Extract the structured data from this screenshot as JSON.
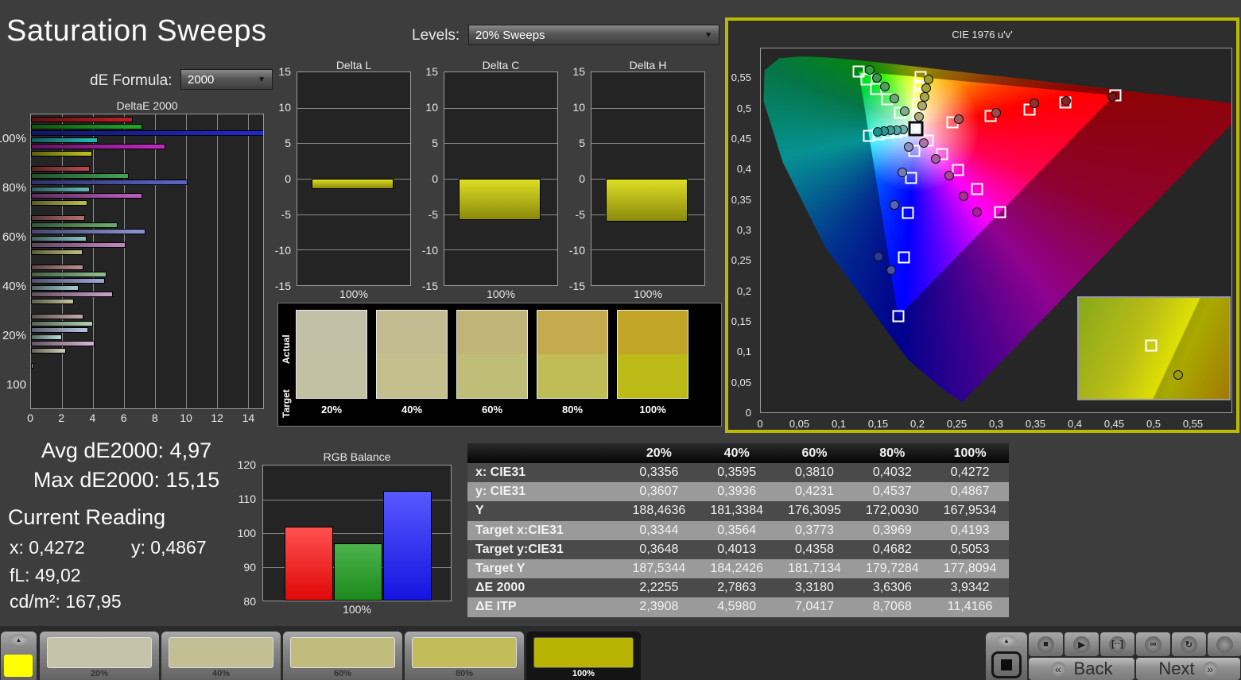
{
  "app": {
    "title": "Saturation Sweeps"
  },
  "icons": {
    "chevron_down": "▼",
    "chevron_up": "▲",
    "back_chevrons": "«",
    "next_chevrons": "»"
  },
  "controls": {
    "de_formula": {
      "label": "dE Formula:",
      "value": "2000"
    },
    "levels": {
      "label": "Levels:",
      "value": "20% Sweeps"
    }
  },
  "summary": {
    "avg_label": "Avg dE2000:",
    "avg_value": "4,97",
    "max_label": "Max dE2000:",
    "max_value": "15,15"
  },
  "current_reading": {
    "title": "Current Reading",
    "x_label": "x:",
    "x_value": "0,4272",
    "y_label": "y:",
    "y_value": "0,4867",
    "fl_label": "fL:",
    "fl_value": "49,02",
    "cd_label": "cd/m²:",
    "cd_value": "167,95"
  },
  "chart_data": [
    {
      "id": "deltae2000",
      "type": "bar",
      "orientation": "horizontal",
      "title": "DeltaE 2000",
      "xlim": [
        0,
        15
      ],
      "xticks": [
        0,
        2,
        4,
        6,
        8,
        10,
        12,
        14
      ],
      "groups": [
        {
          "label": "100%",
          "values": [
            6.6,
            7.2,
            15.15,
            4.3,
            8.7,
            3.93
          ],
          "colors": [
            "#b52025",
            "#21a228",
            "#2028c8",
            "#27b4b4",
            "#bb28bb",
            "#bcbc22"
          ]
        },
        {
          "label": "80%",
          "values": [
            3.8,
            6.3,
            10.1,
            3.8,
            7.2,
            3.63
          ],
          "colors": [
            "#b04a4a",
            "#3f9f4f",
            "#5a62c4",
            "#62b2b2",
            "#b75ab7",
            "#b5b54a"
          ]
        },
        {
          "label": "60%",
          "values": [
            3.5,
            5.6,
            7.4,
            3.6,
            6.1,
            3.32
          ],
          "colors": [
            "#b06a6a",
            "#6aa86a",
            "#8890cc",
            "#84bcbc",
            "#bd84bd",
            "#b7b77a"
          ]
        },
        {
          "label": "40%",
          "values": [
            3.4,
            4.9,
            4.8,
            3.1,
            5.3,
            2.79
          ],
          "colors": [
            "#b88888",
            "#8cba8c",
            "#9aa2d6",
            "#9cc6c6",
            "#c49cc4",
            "#bcbc96"
          ]
        },
        {
          "label": "20%",
          "values": [
            3.4,
            4.0,
            3.7,
            2.0,
            4.1,
            2.24
          ],
          "colors": [
            "#c0a4a4",
            "#aacaaa",
            "#b4bce0",
            "#b0d4d4",
            "#ccb0cc",
            "#c6c6b0"
          ]
        },
        {
          "label": "100",
          "values": [
            0.15
          ],
          "colors": [
            "#e8e8e8"
          ]
        }
      ],
      "series_names": [
        "Red",
        "Green",
        "Blue",
        "Cyan",
        "Magenta",
        "Yellow"
      ]
    },
    {
      "id": "delta-l",
      "type": "bar",
      "title": "Delta L",
      "xlabel": "100%",
      "categories": [
        "100%"
      ],
      "values": [
        -1.5
      ],
      "ylim": [
        -15,
        15
      ],
      "yticks": [
        15,
        10,
        5,
        0,
        -5,
        -10,
        -15
      ]
    },
    {
      "id": "delta-c",
      "type": "bar",
      "title": "Delta C",
      "xlabel": "100%",
      "categories": [
        "100%"
      ],
      "values": [
        -5.8
      ],
      "ylim": [
        -15,
        15
      ],
      "yticks": [
        15,
        10,
        5,
        0,
        -5,
        -10,
        -15
      ]
    },
    {
      "id": "delta-h",
      "type": "bar",
      "title": "Delta H",
      "xlabel": "100%",
      "categories": [
        "100%"
      ],
      "values": [
        -6.0
      ],
      "ylim": [
        -15,
        15
      ],
      "yticks": [
        15,
        10,
        5,
        0,
        -5,
        -10,
        -15
      ]
    },
    {
      "id": "rgb-balance",
      "type": "bar",
      "title": "RGB Balance",
      "xlabel": "100%",
      "categories": [
        "100%"
      ],
      "ylim": [
        80,
        120
      ],
      "yticks": [
        120,
        110,
        100,
        90,
        80
      ],
      "series": [
        {
          "name": "Red",
          "value": 102,
          "color_top": "#ff5050",
          "color_bottom": "#e00808"
        },
        {
          "name": "Green",
          "value": 97,
          "color_top": "#4db34d",
          "color_bottom": "#1b8a1b"
        },
        {
          "name": "Blue",
          "value": 112.5,
          "color_top": "#5858ff",
          "color_bottom": "#1414e0"
        }
      ]
    },
    {
      "id": "cie",
      "type": "scatter",
      "title": "CIE 1976 u'v'",
      "xlim": [
        0,
        0.6
      ],
      "ylim": [
        0,
        0.6
      ],
      "tick_values": [
        0,
        0.05,
        0.1,
        0.15,
        0.2,
        0.25,
        0.3,
        0.35,
        0.4,
        0.45,
        0.5,
        0.55
      ],
      "tick_labels": [
        "0",
        "0,05",
        "0,1",
        "0,15",
        "0,2",
        "0,25",
        "0,3",
        "0,35",
        "0,4",
        "0,45",
        "0,5",
        "0,55"
      ],
      "white_point": {
        "u": 0.1978,
        "v": 0.4683
      },
      "targets": [
        {
          "u": 0.2442,
          "v": 0.4783
        },
        {
          "u": 0.2926,
          "v": 0.4888
        },
        {
          "u": 0.343,
          "v": 0.4996
        },
        {
          "u": 0.388,
          "v": 0.511
        },
        {
          "u": 0.4516,
          "v": 0.5229
        },
        {
          "u": 0.1778,
          "v": 0.4942
        },
        {
          "u": 0.1612,
          "v": 0.5157
        },
        {
          "u": 0.1472,
          "v": 0.5338
        },
        {
          "u": 0.1353,
          "v": 0.5492
        },
        {
          "u": 0.125,
          "v": 0.5625
        },
        {
          "u": 0.1952,
          "v": 0.4314
        },
        {
          "u": 0.1919,
          "v": 0.386
        },
        {
          "u": 0.1878,
          "v": 0.3293
        },
        {
          "u": 0.1825,
          "v": 0.256
        },
        {
          "u": 0.1754,
          "v": 0.1579
        },
        {
          "u": 0.1857,
          "v": 0.4657
        },
        {
          "u": 0.1737,
          "v": 0.4631
        },
        {
          "u": 0.1617,
          "v": 0.4605
        },
        {
          "u": 0.15,
          "v": 0.458
        },
        {
          "u": 0.1383,
          "v": 0.4555
        },
        {
          "u": 0.2131,
          "v": 0.4485
        },
        {
          "u": 0.2308,
          "v": 0.4257
        },
        {
          "u": 0.2514,
          "v": 0.3991
        },
        {
          "u": 0.2758,
          "v": 0.3676
        },
        {
          "u": 0.305,
          "v": 0.3298
        },
        {
          "u": 0.1994,
          "v": 0.4894
        },
        {
          "u": 0.2007,
          "v": 0.5085
        },
        {
          "u": 0.2019,
          "v": 0.5247
        },
        {
          "u": 0.2029,
          "v": 0.5385
        },
        {
          "u": 0.2039,
          "v": 0.5529
        }
      ],
      "measurements": [
        {
          "u": 0.252,
          "v": 0.483,
          "color": "#a85858"
        },
        {
          "u": 0.3,
          "v": 0.494,
          "color": "#a34848"
        },
        {
          "u": 0.349,
          "v": 0.51,
          "color": "#992e2e"
        },
        {
          "u": 0.389,
          "v": 0.514,
          "color": "#8e2020"
        },
        {
          "u": 0.448,
          "v": 0.52,
          "color": "#7a1414"
        },
        {
          "u": 0.183,
          "v": 0.496,
          "color": "#7fae8b"
        },
        {
          "u": 0.17,
          "v": 0.518,
          "color": "#6aa878"
        },
        {
          "u": 0.158,
          "v": 0.537,
          "color": "#4f9f60"
        },
        {
          "u": 0.148,
          "v": 0.552,
          "color": "#3b9a4c"
        },
        {
          "u": 0.139,
          "v": 0.564,
          "color": "#2f9f3f"
        },
        {
          "u": 0.189,
          "v": 0.438,
          "color": "#8890c0"
        },
        {
          "u": 0.18,
          "v": 0.395,
          "color": "#727cba"
        },
        {
          "u": 0.17,
          "v": 0.342,
          "color": "#5a64b2"
        },
        {
          "u": 0.166,
          "v": 0.235,
          "color": "#4650a8"
        },
        {
          "u": 0.15,
          "v": 0.257,
          "color": "#2c3a9a"
        },
        {
          "u": 0.181,
          "v": 0.466,
          "color": "#68b0ac"
        },
        {
          "u": 0.173,
          "v": 0.465,
          "color": "#50a8a4"
        },
        {
          "u": 0.165,
          "v": 0.4645,
          "color": "#3aa09c"
        },
        {
          "u": 0.157,
          "v": 0.4635,
          "color": "#2a9894"
        },
        {
          "u": 0.149,
          "v": 0.4625,
          "color": "#1a918c"
        },
        {
          "u": 0.208,
          "v": 0.444,
          "color": "#ad74a6"
        },
        {
          "u": 0.223,
          "v": 0.418,
          "color": "#a85f9e"
        },
        {
          "u": 0.24,
          "v": 0.39,
          "color": "#a84694"
        },
        {
          "u": 0.258,
          "v": 0.356,
          "color": "#ab3093"
        },
        {
          "u": 0.276,
          "v": 0.33,
          "color": "#b517a0"
        },
        {
          "u": 0.2016,
          "v": 0.4876,
          "color": "#b0ac7c"
        },
        {
          "u": 0.2053,
          "v": 0.5058,
          "color": "#aca866"
        },
        {
          "u": 0.2083,
          "v": 0.5206,
          "color": "#a8a450"
        },
        {
          "u": 0.2112,
          "v": 0.5346,
          "color": "#a4a03a"
        },
        {
          "u": 0.214,
          "v": 0.5485,
          "color": "#a0a024"
        }
      ],
      "inset": {
        "square": {
          "x": 48,
          "y": 47
        },
        "circle": {
          "x": 66,
          "y": 76,
          "color": "#9a9a10"
        }
      }
    }
  ],
  "sample_panel": {
    "row_labels": [
      "Actual",
      "Target"
    ],
    "columns": [
      {
        "label": "20%",
        "actual": "#c3c0a8",
        "target": "#c3c1a3"
      },
      {
        "label": "40%",
        "actual": "#c3bc92",
        "target": "#c3c08e"
      },
      {
        "label": "60%",
        "actual": "#c0b478",
        "target": "#bfbd78"
      },
      {
        "label": "80%",
        "actual": "#c5ab4d",
        "target": "#c0bd57"
      },
      {
        "label": "100%",
        "actual": "#c2a426",
        "target": "#bcba16"
      }
    ]
  },
  "table": {
    "columns": [
      "20%",
      "40%",
      "60%",
      "80%",
      "100%"
    ],
    "rows": [
      {
        "label": "x: CIE31",
        "values": [
          "0,3356",
          "0,3595",
          "0,3810",
          "0,4032",
          "0,4272"
        ]
      },
      {
        "label": "y: CIE31",
        "values": [
          "0,3607",
          "0,3936",
          "0,4231",
          "0,4537",
          "0,4867"
        ]
      },
      {
        "label": "Y",
        "values": [
          "188,4636",
          "181,3384",
          "176,3095",
          "172,0030",
          "167,9534"
        ]
      },
      {
        "label": "Target x:CIE31",
        "values": [
          "0,3344",
          "0,3564",
          "0,3773",
          "0,3969",
          "0,4193"
        ]
      },
      {
        "label": "Target y:CIE31",
        "values": [
          "0,3648",
          "0,4013",
          "0,4358",
          "0,4682",
          "0,5053"
        ]
      },
      {
        "label": "Target Y",
        "values": [
          "187,5344",
          "184,2426",
          "181,7134",
          "179,7284",
          "177,8094"
        ]
      },
      {
        "label": "ΔE 2000",
        "values": [
          "2,2255",
          "2,7863",
          "3,3180",
          "3,6306",
          "3,9342"
        ]
      },
      {
        "label": "ΔE ITP",
        "values": [
          "2,3908",
          "4,5980",
          "7,0417",
          "8,7068",
          "11,4166"
        ]
      }
    ]
  },
  "bottom_bar": {
    "current_patch_color": "#ffff00",
    "patches": [
      {
        "label": "20%",
        "color": "#c5c3aa",
        "selected": false
      },
      {
        "label": "40%",
        "color": "#c2bf95",
        "selected": false
      },
      {
        "label": "60%",
        "color": "#c1bc7b",
        "selected": false
      },
      {
        "label": "80%",
        "color": "#c3bc5a",
        "selected": false
      },
      {
        "label": "100%",
        "color": "#b9b303",
        "selected": true
      }
    ],
    "transport": [
      {
        "name": "stop",
        "glyph": "■"
      },
      {
        "name": "play",
        "glyph": "▶"
      },
      {
        "name": "step",
        "glyph": "[··]"
      },
      {
        "name": "continuous",
        "glyph": "∞"
      },
      {
        "name": "refresh",
        "glyph": "↻"
      },
      {
        "name": "record",
        "glyph": ""
      }
    ],
    "back_label": "Back",
    "next_label": "Next"
  }
}
